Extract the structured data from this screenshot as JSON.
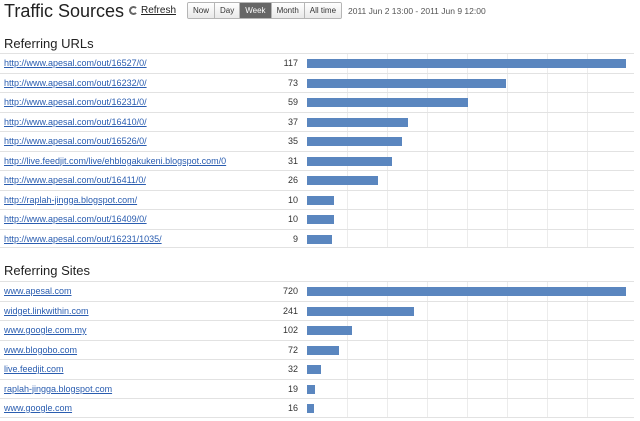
{
  "header": {
    "title": "Traffic Sources",
    "refresh_label": "Refresh",
    "ranges": [
      {
        "label": "Now",
        "active": false
      },
      {
        "label": "Day",
        "active": false
      },
      {
        "label": "Week",
        "active": true
      },
      {
        "label": "Month",
        "active": false
      },
      {
        "label": "All time",
        "active": false
      }
    ],
    "date_range": "2011 Jun 2 13:00 - 2011 Jun 9 12:00"
  },
  "colors": {
    "bar": "#5a86bf",
    "link": "#2a5db0",
    "active_range_bg": "#666666"
  },
  "referring_urls": {
    "title": "Referring URLs",
    "max": 117,
    "rows": [
      {
        "url": "http://www.apesal.com/out/16527/0/",
        "count": 117
      },
      {
        "url": "http://www.apesal.com/out/16232/0/",
        "count": 73
      },
      {
        "url": "http://www.apesal.com/out/16231/0/",
        "count": 59
      },
      {
        "url": "http://www.apesal.com/out/16410/0/",
        "count": 37
      },
      {
        "url": "http://www.apesal.com/out/16526/0/",
        "count": 35
      },
      {
        "url": "http://live.feedjit.com/live/ehblogakukeni.blogspot.com/0",
        "count": 31
      },
      {
        "url": "http://www.apesal.com/out/16411/0/",
        "count": 26
      },
      {
        "url": "http://raplah-jingga.blogspot.com/",
        "count": 10
      },
      {
        "url": "http://www.apesal.com/out/16409/0/",
        "count": 10
      },
      {
        "url": "http://www.apesal.com/out/16231/1035/",
        "count": 9
      }
    ]
  },
  "referring_sites": {
    "title": "Referring Sites",
    "max": 720,
    "rows": [
      {
        "url": "www.apesal.com",
        "count": 720
      },
      {
        "url": "widget.linkwithin.com",
        "count": 241
      },
      {
        "url": "www.google.com.my",
        "count": 102
      },
      {
        "url": "www.blogobo.com",
        "count": 72
      },
      {
        "url": "live.feedjit.com",
        "count": 32
      },
      {
        "url": "raplah-jingga.blogspot.com",
        "count": 19
      },
      {
        "url": "www.google.com",
        "count": 16
      }
    ]
  }
}
